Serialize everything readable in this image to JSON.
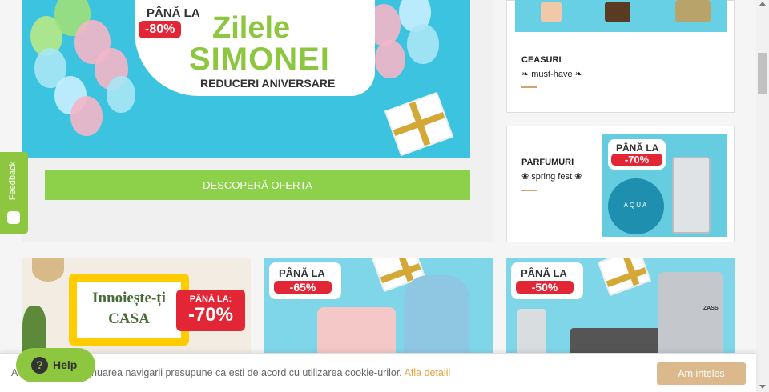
{
  "hero": {
    "upto": "PÂNĂ LA",
    "discount": "-80%",
    "title_line1": "Zilele",
    "title_line2": "SIMONEI",
    "subtitle": "REDUCERI ANIVERSARE",
    "button_label": "DESCOPERĂ OFERTA"
  },
  "categories": [
    {
      "title": "CEASURI",
      "subtitle": "❧ must-have ❧"
    },
    {
      "title": "PARFUMURI",
      "subtitle": "❀ spring fest ❀",
      "badge_upto": "PÂNĂ LA",
      "badge_discount": "-70%",
      "product_label": "AQUA"
    }
  ],
  "tiles": [
    {
      "line1": "Innoiește-ți",
      "line2": "CASA",
      "badge_upto": "PÂNĂ LA:",
      "badge_discount": "-70%"
    },
    {
      "badge_upto": "PÂNĂ LA",
      "badge_discount": "-65%"
    },
    {
      "badge_upto": "PÂNĂ LA",
      "badge_discount": "-50%",
      "product_label": "ZASS"
    }
  ],
  "feedback": {
    "label": "Feedback"
  },
  "cookie": {
    "text": "A    e cookies. Continuarea navigarii presupune ca esti de acord cu utilizarea cookie-urilor.",
    "link": "Afla detalii",
    "button": "Am inteles"
  },
  "help": {
    "label": "Help",
    "icon": "?"
  },
  "colors": {
    "green": "#8dc63f",
    "red": "#e32636",
    "cyan": "#3cc3e0",
    "cookie_button": "#dcb98c"
  }
}
